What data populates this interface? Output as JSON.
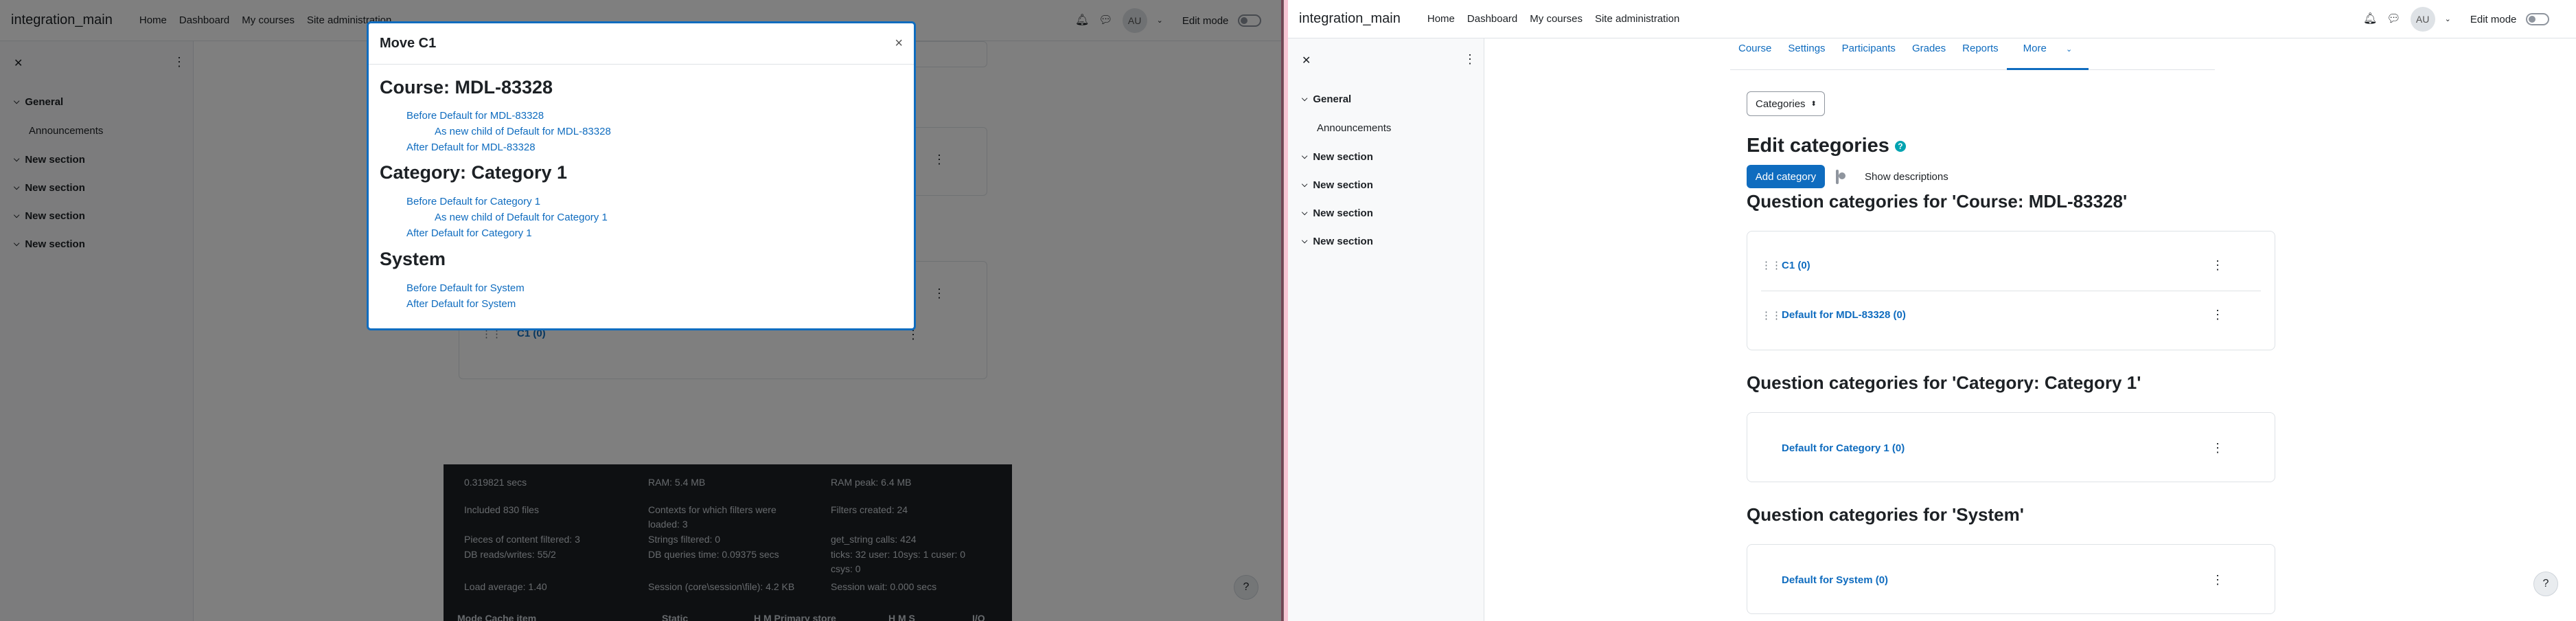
{
  "left": {
    "brand": "integration_main",
    "nav": [
      "Home",
      "Dashboard",
      "My courses",
      "Site administration"
    ],
    "avatar": "AU",
    "edit_mode": "Edit mode",
    "drawer": {
      "sections": [
        "General",
        "New section",
        "New section",
        "New section",
        "New section"
      ],
      "sub": "Announcements"
    },
    "bg_category": "C1 (0)",
    "modal": {
      "title": "Move C1",
      "close": "×",
      "groups": [
        {
          "heading": "Course: MDL-83328",
          "links": [
            "Before Default for MDL-83328",
            "As new child of Default for MDL-83328",
            "After Default for MDL-83328"
          ]
        },
        {
          "heading": "Category: Category 1",
          "links": [
            "Before Default for Category 1",
            "As new child of Default for Category 1",
            "After Default for Category 1"
          ]
        },
        {
          "heading": "System",
          "links": [
            "Before Default for System",
            "After Default for System"
          ]
        }
      ]
    },
    "perf": {
      "c1": [
        "0.319821 secs",
        "Included 830 files",
        "Pieces of content filtered: 3",
        "DB reads/writes: 55/2",
        "Load average: 1.40",
        "Mode  Cache item"
      ],
      "c2": [
        "RAM: 5.4 MB",
        "Contexts for which filters were",
        "loaded: 3",
        "Strings filtered: 0",
        "DB queries time: 0.09375 secs",
        "Session (core\\session\\file): 4.2 KB",
        "Static"
      ],
      "c3": [
        "RAM peak: 6.4 MB",
        "Filters created: 24",
        "get_string calls: 424",
        "ticks: 32 user: 10sys: 1 cuser: 0",
        "csys: 0",
        "Session wait: 0.000 secs",
        "H   M   Primary store",
        "H   M   S",
        "I/O"
      ]
    }
  },
  "right": {
    "brand": "integration_main",
    "nav": [
      "Home",
      "Dashboard",
      "My courses",
      "Site administration"
    ],
    "avatar": "AU",
    "edit_mode": "Edit mode",
    "drawer": {
      "sections": [
        "General",
        "New section",
        "New section",
        "New section",
        "New section"
      ],
      "sub": "Announcements"
    },
    "tabs": [
      "Course",
      "Settings",
      "Participants",
      "Grades",
      "Reports",
      "More"
    ],
    "select_value": "Categories",
    "title": "Edit categories",
    "add_category": "Add category",
    "show_descriptions": "Show descriptions",
    "sections": [
      {
        "heading": "Question categories for 'Course: MDL-83328'",
        "items": [
          "C1 (0)",
          "Default for MDL-83328 (0)"
        ]
      },
      {
        "heading": "Question categories for 'Category: Category 1'",
        "items": [
          "Default for Category 1 (0)"
        ]
      },
      {
        "heading": "Question categories for 'System'",
        "items": [
          "Default for System (0)"
        ]
      }
    ]
  }
}
